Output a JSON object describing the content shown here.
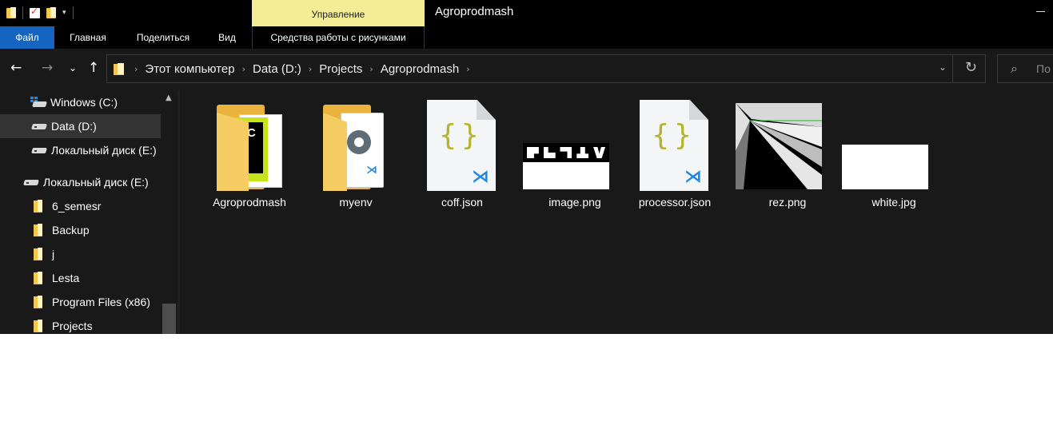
{
  "window": {
    "title": "Agroprodmash",
    "context_tab": "Управление"
  },
  "ribbon": {
    "tabs": [
      "Файл",
      "Главная",
      "Поделиться",
      "Вид"
    ],
    "context_label": "Средства работы с рисунками"
  },
  "address": {
    "crumbs": [
      "Этот компьютер",
      "Data (D:)",
      "Projects",
      "Agroprodmash"
    ],
    "search_placeholder": "По"
  },
  "nav": {
    "items": [
      {
        "label": "Windows (C:)",
        "icon": "windows-drive-icon",
        "selected": false
      },
      {
        "label": "Data (D:)",
        "icon": "drive-icon",
        "selected": true
      },
      {
        "label": "Локальный диск (E:)",
        "icon": "drive-icon",
        "selected": false
      },
      {
        "label": "Локальный диск (E:)",
        "icon": "drive-icon",
        "selected": false
      },
      {
        "label": "6_semesr",
        "icon": "folder-icon",
        "selected": false
      },
      {
        "label": "Backup",
        "icon": "folder-icon",
        "selected": false
      },
      {
        "label": "j",
        "icon": "folder-icon",
        "selected": false
      },
      {
        "label": "Lesta",
        "icon": "folder-icon",
        "selected": false
      },
      {
        "label": "Program Files (x86)",
        "icon": "folder-icon",
        "selected": false
      },
      {
        "label": "Projects",
        "icon": "folder-icon",
        "selected": false
      }
    ]
  },
  "files": [
    {
      "name": "Agroprodmash",
      "type": "folder",
      "icon": "pycharm-folder-icon"
    },
    {
      "name": "myenv",
      "type": "folder",
      "icon": "settings-folder-icon"
    },
    {
      "name": "coff.json",
      "type": "json",
      "icon": "json-file-icon"
    },
    {
      "name": "image.png",
      "type": "image",
      "icon": "image-thumbnail"
    },
    {
      "name": "processor.json",
      "type": "json",
      "icon": "json-file-icon"
    },
    {
      "name": "rez.png",
      "type": "image",
      "icon": "image-thumbnail"
    },
    {
      "name": "white.jpg",
      "type": "image",
      "icon": "image-thumbnail"
    }
  ],
  "colors": {
    "accent": "#1565c0",
    "context_tab": "#f3ee96",
    "background": "#191919",
    "folder": "#f3c74c"
  }
}
